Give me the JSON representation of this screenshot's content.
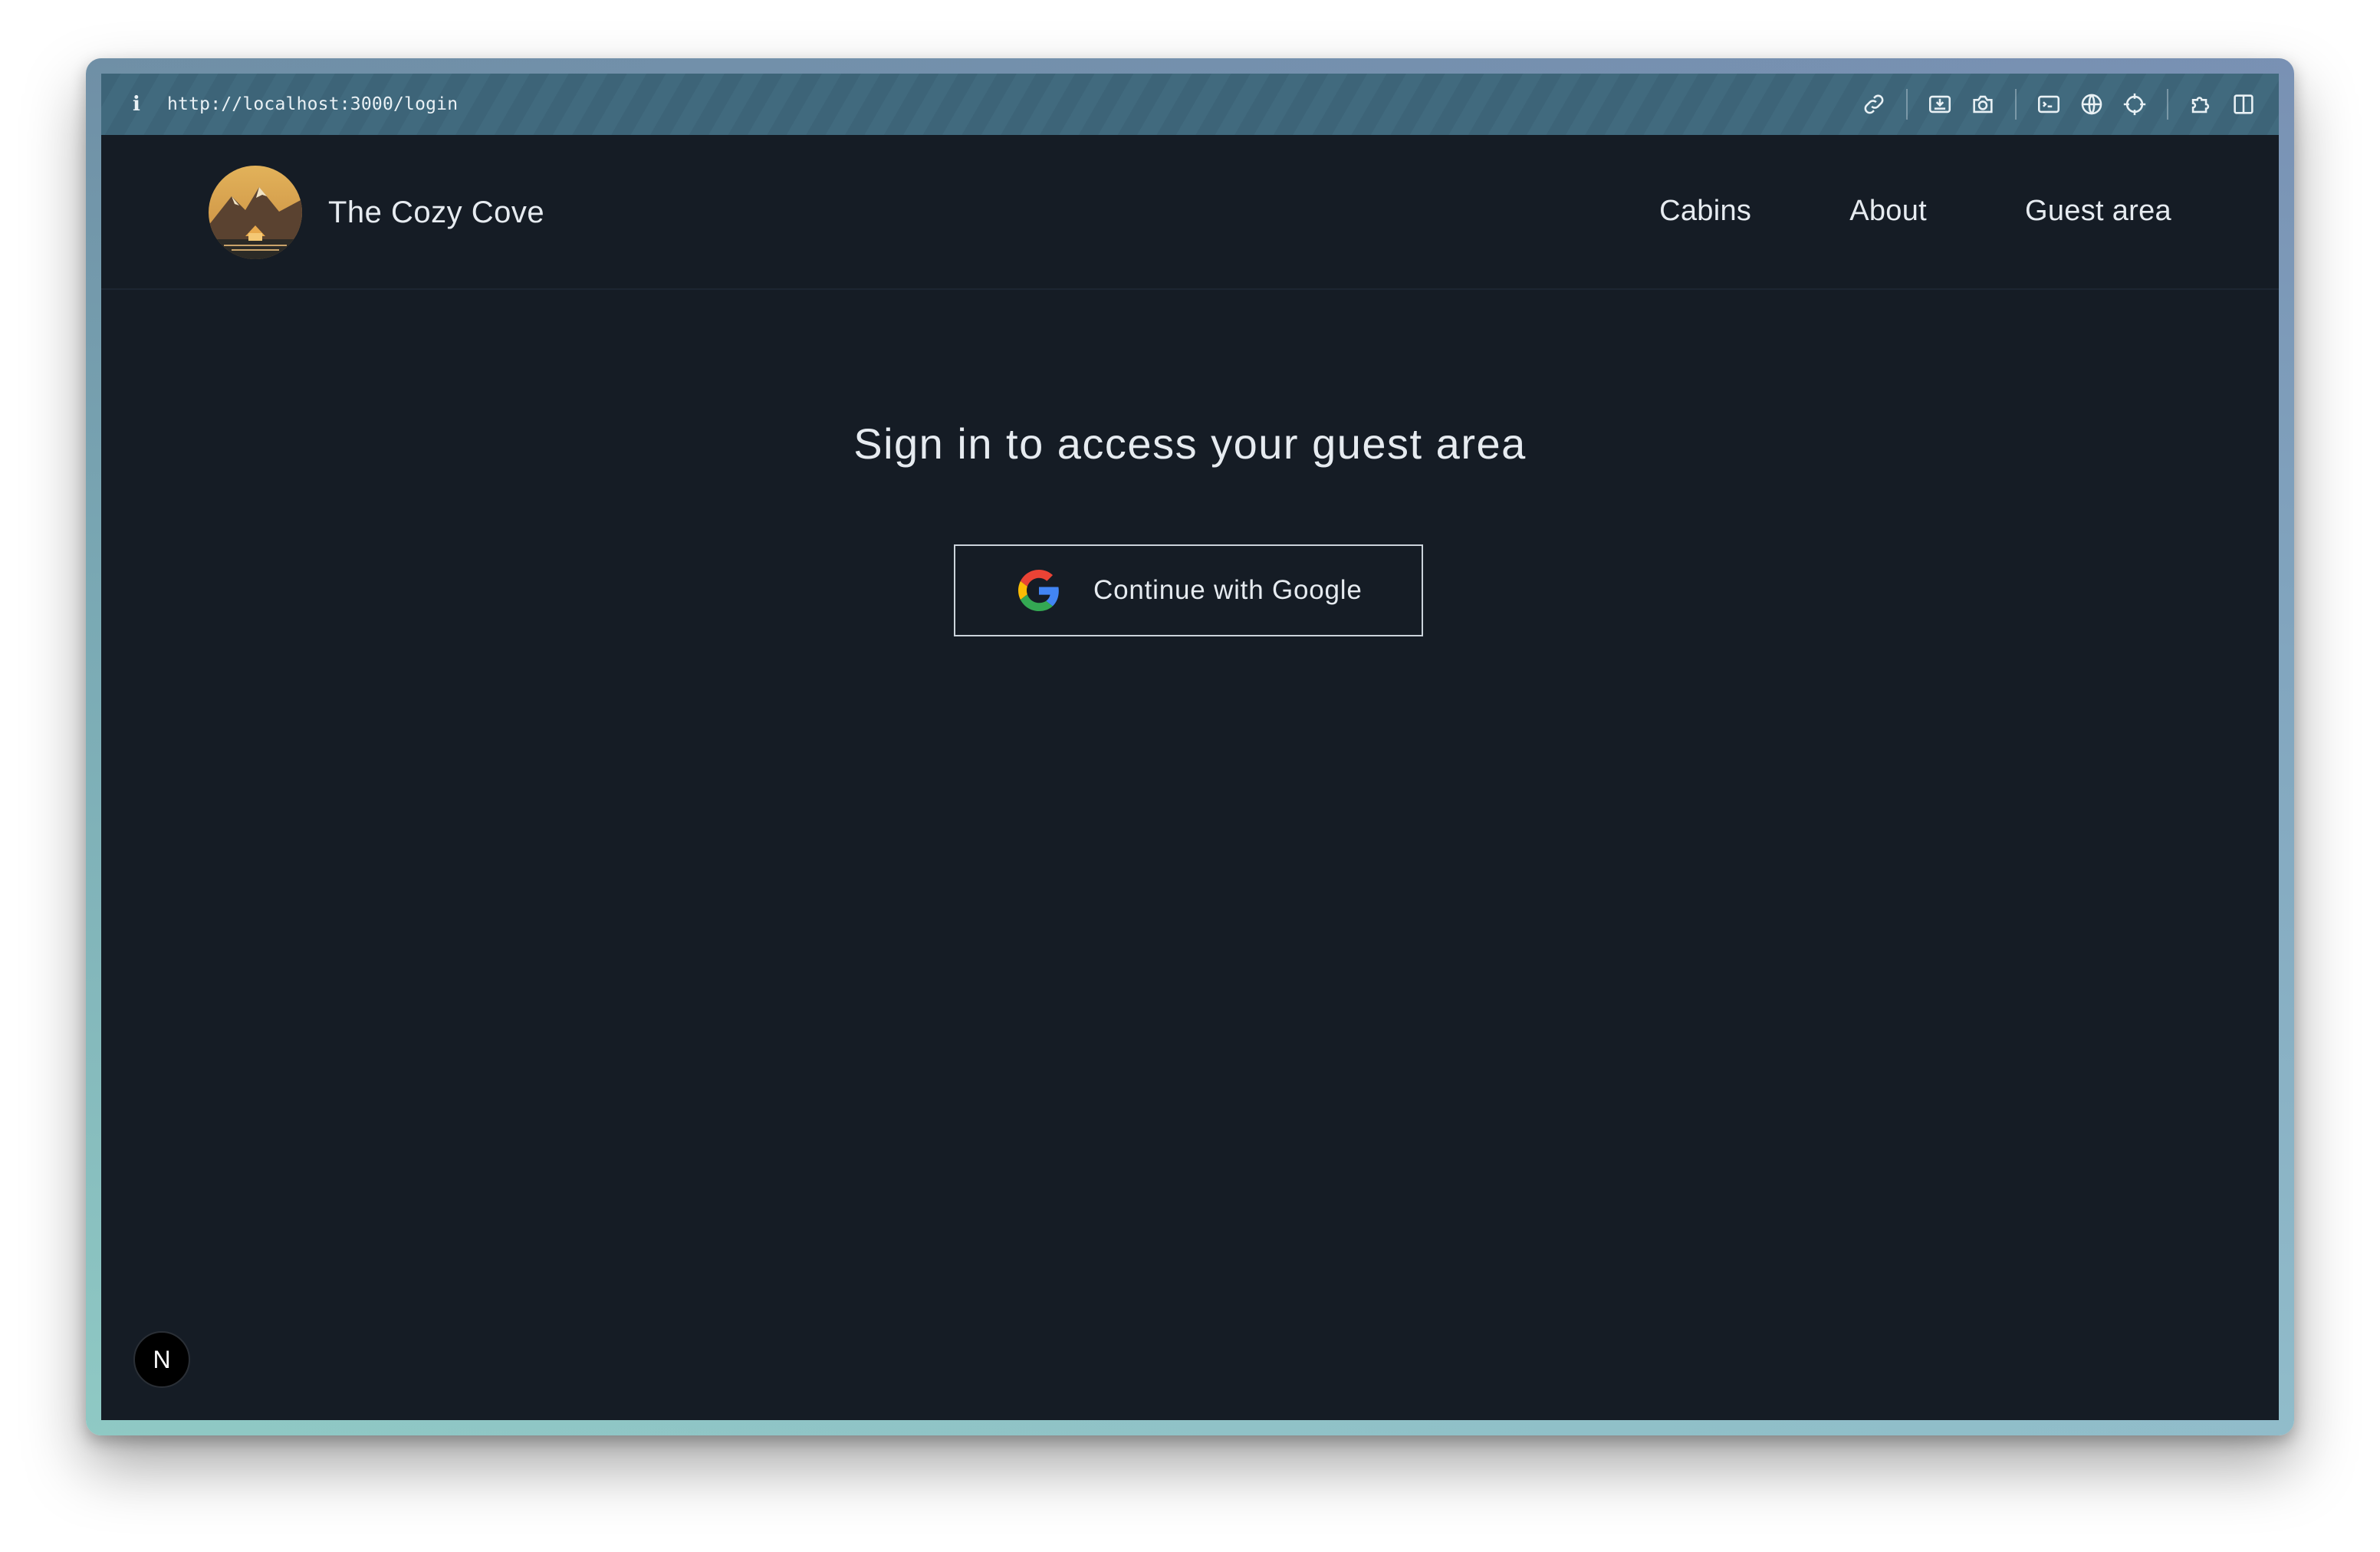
{
  "browser": {
    "info_glyph": "i",
    "url": "http://localhost:3000/login",
    "toolbar_icons": [
      "link-icon",
      "screenshot-area-icon",
      "camera-icon",
      "terminal-icon",
      "globe-icon",
      "crosshair-icon",
      "extension-icon",
      "split-view-icon"
    ]
  },
  "site": {
    "brand": "The Cozy Cove",
    "nav": [
      {
        "label": "Cabins"
      },
      {
        "label": "About"
      },
      {
        "label": "Guest area"
      }
    ]
  },
  "login": {
    "heading": "Sign in to access your guest area",
    "google_button": "Continue with Google"
  },
  "dev_badge": {
    "label": "N"
  },
  "colors": {
    "background": "#151c25",
    "text": "#e6ebf0",
    "urlbar": "#3d6478"
  }
}
